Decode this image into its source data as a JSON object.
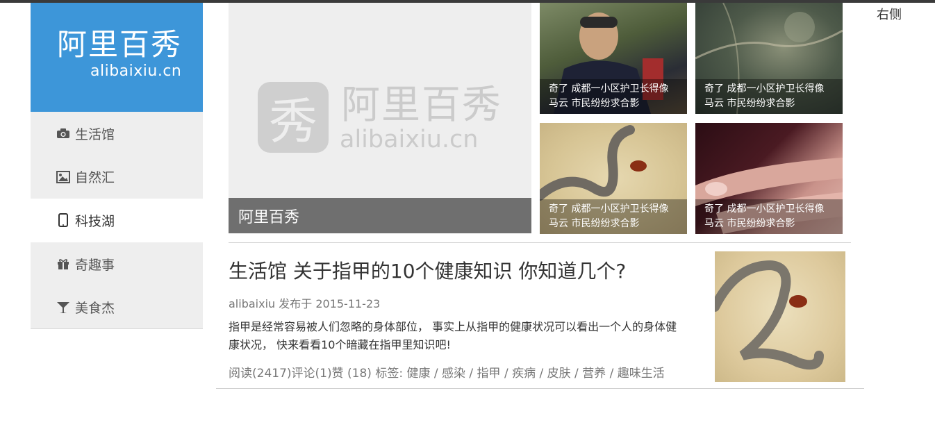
{
  "logo": {
    "cn": "阿里百秀",
    "en": "alibaixiu.cn"
  },
  "nav": [
    {
      "label": "生活馆",
      "icon": "camera-icon"
    },
    {
      "label": "自然汇",
      "icon": "image-icon"
    },
    {
      "label": "科技湖",
      "icon": "mobile-icon",
      "active": true
    },
    {
      "label": "奇趣事",
      "icon": "gift-icon"
    },
    {
      "label": "美食杰",
      "icon": "glass-icon"
    }
  ],
  "slider": {
    "caption": "阿里百秀",
    "watermark_badge": "秀",
    "watermark_cn": "阿里百秀",
    "watermark_en": "alibaixiu.cn"
  },
  "thumbs": [
    {
      "line1": "奇了 成都一小区护卫长得像",
      "line2": "马云 市民纷纷求合影"
    },
    {
      "line1": "奇了 成都一小区护卫长得像",
      "line2": "马云 市民纷纷求合影"
    },
    {
      "line1": "奇了 成都一小区护卫长得像",
      "line2": "马云 市民纷纷求合影"
    },
    {
      "line1": "奇了 成都一小区护卫长得像",
      "line2": "马云 市民纷纷求合影"
    }
  ],
  "right_label": "右侧",
  "article": {
    "title": "生活馆 关于指甲的10个健康知识 你知道几个?",
    "meta": "alibaixiu 发布于 2015-11-23",
    "excerpt": "指甲是经常容易被人们忽略的身体部位， 事实上从指甲的健康状况可以看出一个人的身体健康状况， 快来看看10个暗藏在指甲里知识吧!",
    "stats": "阅读(2417)评论(1)赞 (18) 标签:",
    "tags": [
      "健康",
      "感染",
      "指甲",
      "疾病",
      "皮肤",
      "营养",
      "趣味生活"
    ]
  },
  "colors": {
    "brand_blue": "#3d96d9",
    "nav_bg": "#eeeeee",
    "caption_bg": "#646464"
  }
}
